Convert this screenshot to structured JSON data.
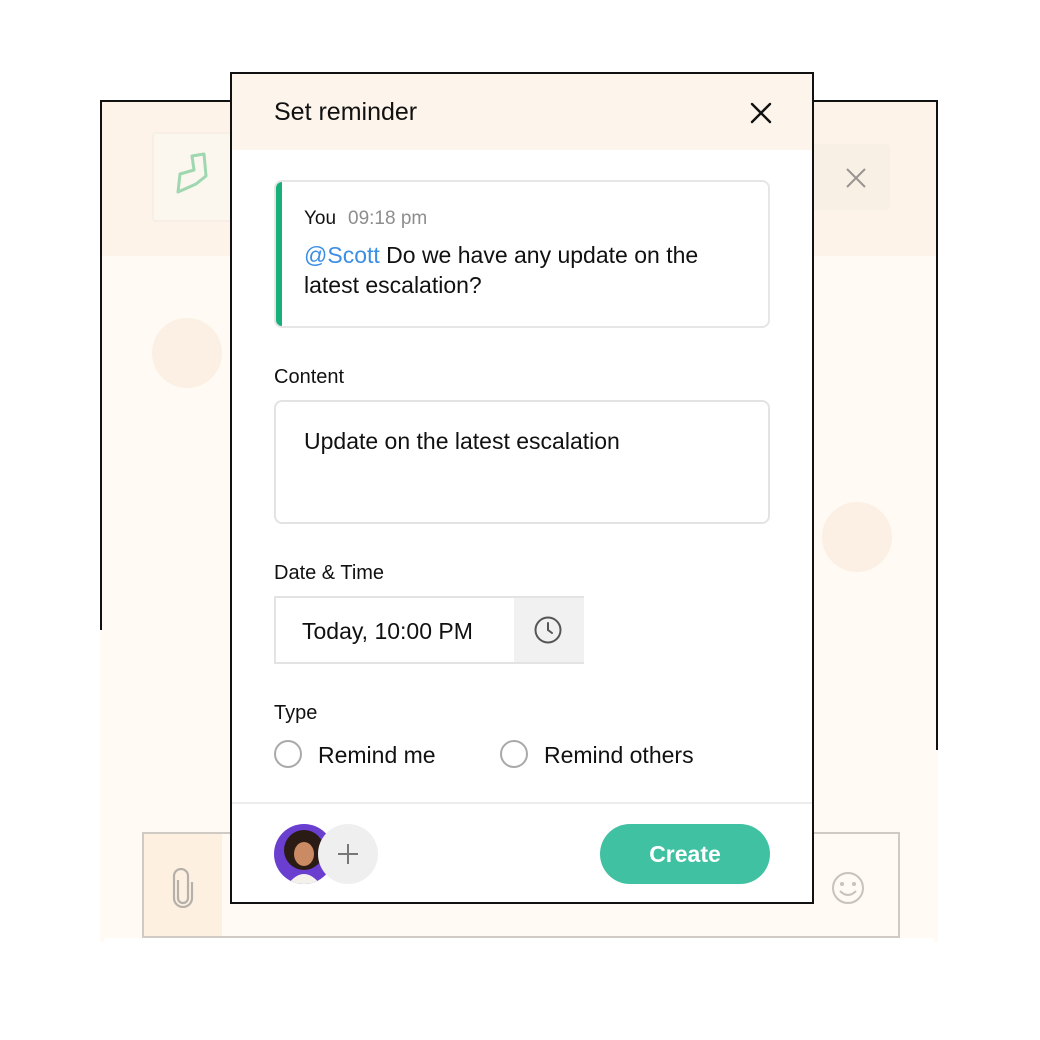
{
  "dialog": {
    "title": "Set reminder",
    "close_icon": "close-icon"
  },
  "message": {
    "author": "You",
    "time": "09:18 pm",
    "mention": "@Scott",
    "text": " Do we have any update on the latest escalation?",
    "accent_color": "#18b07a",
    "mention_color": "#3b8fe3"
  },
  "content": {
    "label": "Content",
    "value": "Update on the latest escalation"
  },
  "datetime": {
    "label": "Date & Time",
    "value": "Today, 10:00 PM",
    "icon": "clock-icon"
  },
  "type": {
    "label": "Type",
    "options": [
      {
        "label": "Remind me",
        "selected": false
      },
      {
        "label": "Remind others",
        "selected": false
      }
    ]
  },
  "footer": {
    "avatar_icon": "user-avatar",
    "add_icon": "plus-icon",
    "create_label": "Create",
    "create_color": "#3fc1a2"
  },
  "background": {
    "logo_icon": "chat-logo-icon",
    "close_icon": "close-icon",
    "attach_icon": "paperclip-icon",
    "emoji_icon": "smiley-icon"
  }
}
